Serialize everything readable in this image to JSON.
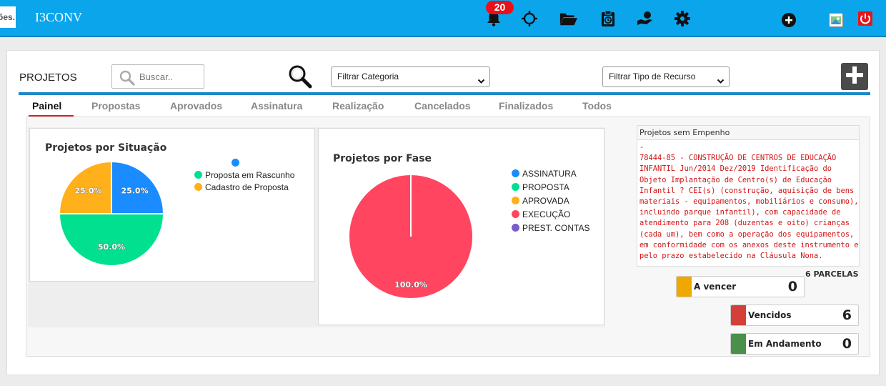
{
  "app": {
    "logo_text": "ões.",
    "title": "I3CONV",
    "notification_count": "20"
  },
  "toolbar": {
    "title": "PROJETOS",
    "search_placeholder": "Buscar..",
    "filter_category": "Filtrar Categoria",
    "filter_resource": "Filtrar Tipo de Recurso"
  },
  "tabs": [
    {
      "label": "Painel"
    },
    {
      "label": "Propostas"
    },
    {
      "label": "Aprovados"
    },
    {
      "label": "Assinatura"
    },
    {
      "label": "Realização"
    },
    {
      "label": "Cancelados"
    },
    {
      "label": "Finalizados"
    },
    {
      "label": "Todos"
    }
  ],
  "chart_data": [
    {
      "type": "pie",
      "title": "Projetos por Situação",
      "categories": [
        "",
        "Proposta em Rascunho",
        "Cadastro de Proposta"
      ],
      "values": [
        25.0,
        50.0,
        25.0
      ],
      "value_labels": [
        "25.0%",
        "50.0%",
        "25.0%"
      ],
      "colors": [
        "#1a8cff",
        "#00e08f",
        "#ffb01a"
      ]
    },
    {
      "type": "pie",
      "title": "Projetos por Fase",
      "categories": [
        "ASSINATURA",
        "PROPOSTA",
        "APROVADA",
        "EXECUÇÃO",
        "PREST. CONTAS"
      ],
      "values": [
        0,
        0,
        0,
        100.0,
        0
      ],
      "value_labels": [
        "",
        "",
        "",
        "100.0%",
        ""
      ],
      "colors": [
        "#1a8cff",
        "#00e08f",
        "#ffb01a",
        "#ff4560",
        "#775dd0"
      ]
    }
  ],
  "empenho": {
    "header": "Projetos sem Empenho",
    "dash": "-",
    "text": "78444-85 - CONSTRUÇÃO DE CENTROS DE EDUCAÇÃO INFANTIL Jun/2014 Dez/2019 Identificação do Objeto Implantação de Centro(s) de Educação Infantil ? CEI(s) (construção, aquisição de bens materiais - equipamentos, mobiliários e consumo), incluindo parque infantil), com capacidade de atendimento para 208 (duzentas e oito) crianças (cada um), bem como a operação dos equipamentos, em conformidade com os anexos deste instrumento e pelo prazo estabelecido na Cláusula Nona."
  },
  "parcelas": {
    "title": "6 PARCELAS",
    "a_vencer": {
      "label": "A vencer",
      "value": "0",
      "color": "#f0a800"
    },
    "vencidos": {
      "label": "Vencidos",
      "value": "6",
      "color": "#d43f3a"
    },
    "em_andamento": {
      "label": "Em Andamento",
      "value": "0",
      "color": "#4a8f4a"
    }
  }
}
